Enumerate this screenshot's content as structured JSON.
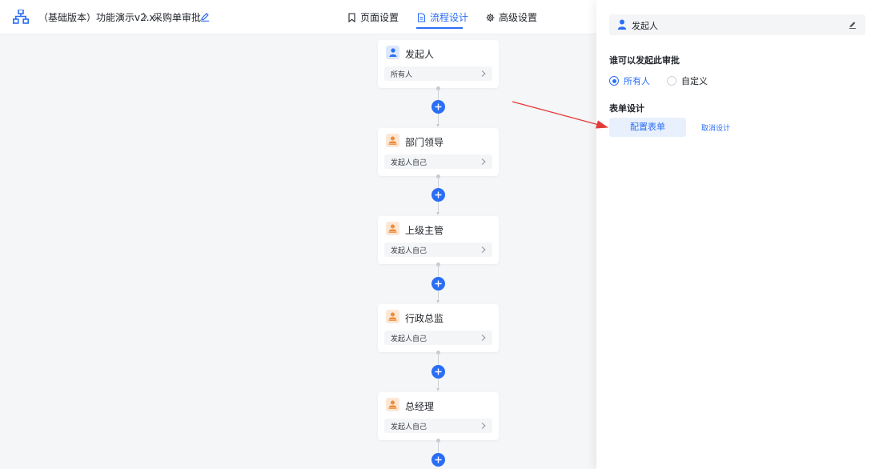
{
  "header": {
    "breadcrumb_app": "（基础版本）功能演示v2.x",
    "breadcrumb_page": "采购单审批",
    "tabs": [
      {
        "label": "页面设置",
        "icon": "bookmark-icon"
      },
      {
        "label": "流程设计",
        "icon": "document-icon",
        "active": true
      },
      {
        "label": "高级设置",
        "icon": "gear-icon"
      }
    ]
  },
  "flow": {
    "nodes": [
      {
        "title": "发起人",
        "sub": "所有人",
        "icon": "user-icon",
        "color": "#2a6ef5"
      },
      {
        "title": "部门领导",
        "sub": "发起人自己",
        "icon": "approver-icon",
        "color": "#f08a35"
      },
      {
        "title": "上级主管",
        "sub": "发起人自己",
        "icon": "approver-icon",
        "color": "#f08a35"
      },
      {
        "title": "行政总监",
        "sub": "发起人自己",
        "icon": "approver-icon",
        "color": "#f08a35"
      },
      {
        "title": "总经理",
        "sub": "发起人自己",
        "icon": "approver-icon",
        "color": "#f08a35"
      }
    ]
  },
  "panel": {
    "title": "发起人",
    "who_label": "谁可以发起此审批",
    "options": [
      {
        "label": "所有人",
        "selected": true
      },
      {
        "label": "自定义",
        "selected": false
      }
    ],
    "form_label": "表单设计",
    "config_button": "配置表单",
    "cancel_link": "取消设计"
  },
  "colors": {
    "accent": "#2a6ef5",
    "approver": "#f08a35",
    "annotation_arrow": "#e53935"
  }
}
